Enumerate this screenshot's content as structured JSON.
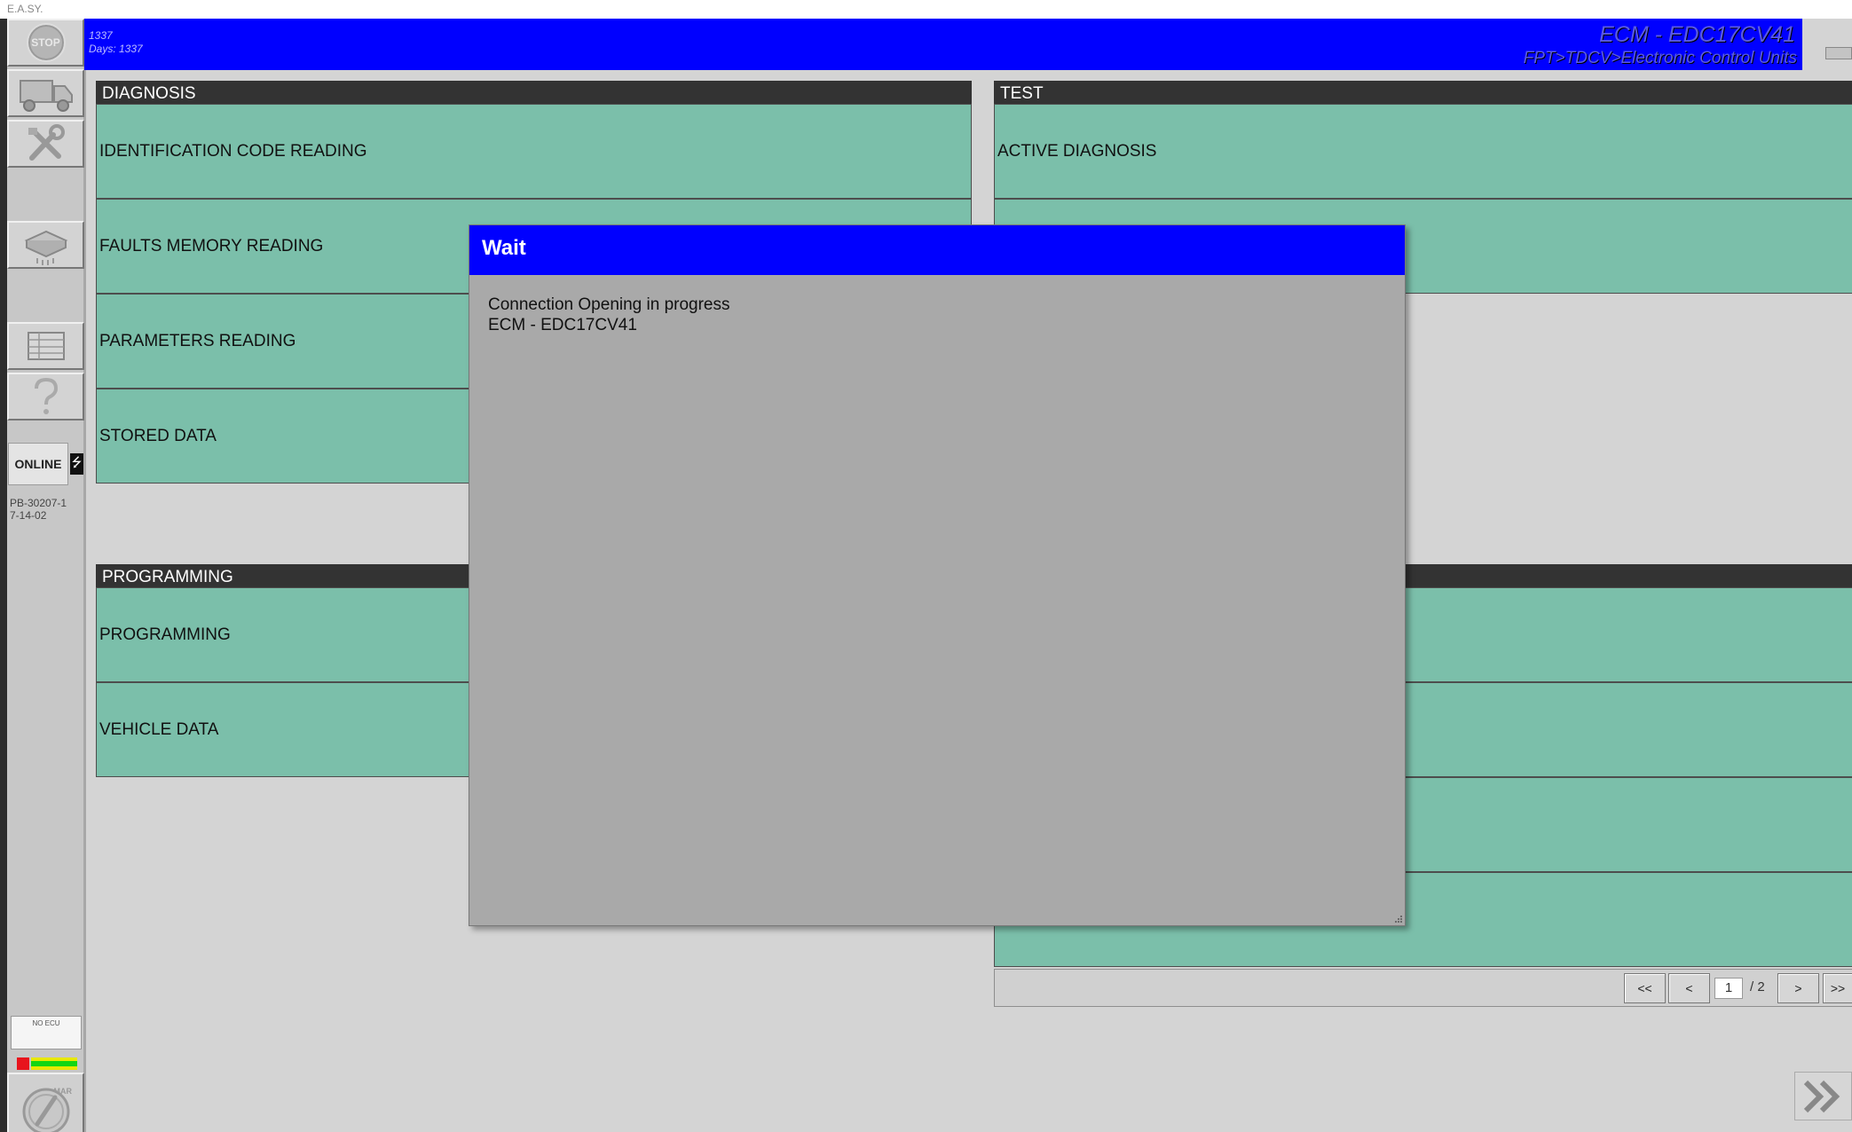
{
  "window": {
    "title": "E.A.SY."
  },
  "sidebar": {
    "stop_label": "STOP",
    "buttons": [
      "truck-icon",
      "tools-icon",
      "ecu-module-icon",
      "table-icon",
      "help-icon"
    ],
    "online_label": "ONLINE",
    "build_label": "PB-30207-17-14-02",
    "ecu_status_label": "NO ECU",
    "mar_label": "MAR",
    "status_colors": {
      "red": "#e8141d",
      "green": "#13d613",
      "yellow": "#e8e800"
    }
  },
  "header": {
    "line1": "1337",
    "line2": "Days: 1337",
    "ecu_title": "ECM - EDC17CV41",
    "breadcrumb": "FPT>TDCV>Electronic Control Units",
    "background": "#0000ff"
  },
  "diagnosis": {
    "title": "DIAGNOSIS",
    "items": [
      "IDENTIFICATION CODE READING",
      "FAULTS MEMORY READING",
      "PARAMETERS READING",
      "STORED DATA"
    ]
  },
  "test": {
    "title": "TEST",
    "items": [
      "ACTIVE DIAGNOSIS",
      ""
    ]
  },
  "programming": {
    "title": "PROGRAMMING",
    "items": [
      "PROGRAMMING",
      "VEHICLE DATA"
    ]
  },
  "pager": {
    "first": "<<",
    "prev": "<",
    "current": "1",
    "total": "/ 2",
    "next": ">",
    "last": ">>"
  },
  "modal": {
    "title": "Wait",
    "message_line1": "Connection Opening in progress",
    "message_line2": "ECM - EDC17CV41"
  },
  "colors": {
    "tile": "#7bbfaa",
    "section_header": "#333333",
    "modal_title": "#0000ff"
  }
}
